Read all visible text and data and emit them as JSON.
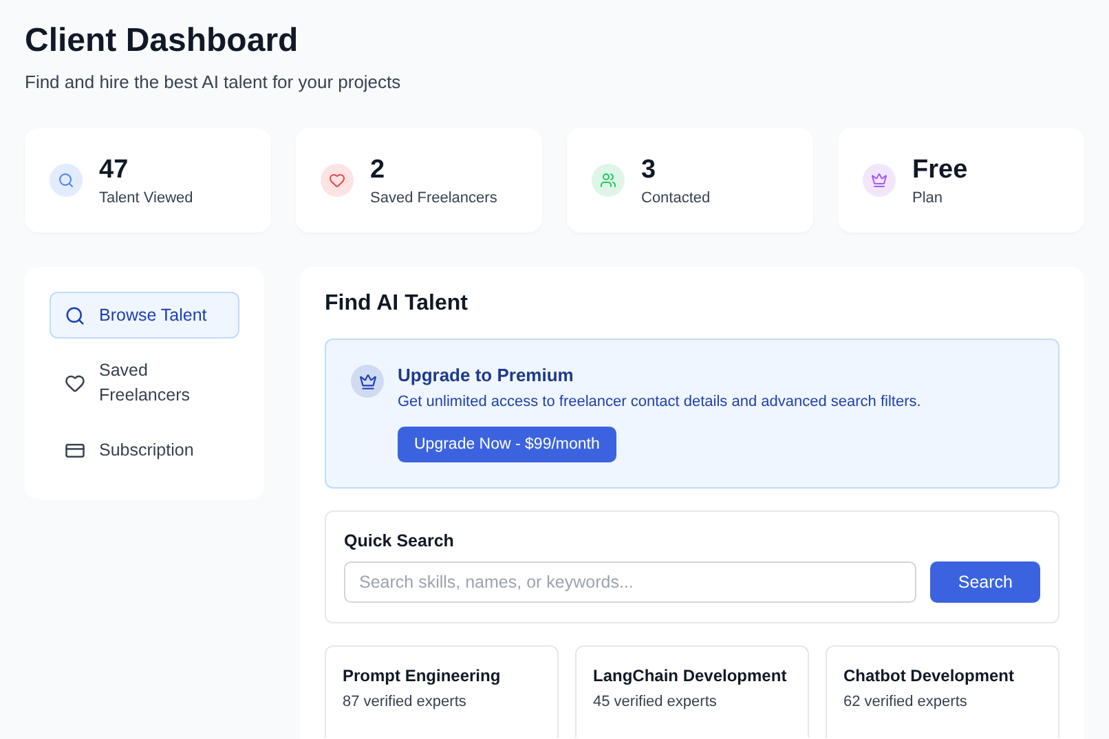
{
  "header": {
    "title": "Client Dashboard",
    "subtitle": "Find and hire the best AI talent for your projects"
  },
  "stats": [
    {
      "value": "47",
      "label": "Talent Viewed",
      "color": "#3b82f6"
    },
    {
      "value": "2",
      "label": "Saved Freelancers",
      "color": "#ef4444"
    },
    {
      "value": "3",
      "label": "Contacted",
      "color": "#22c55e"
    },
    {
      "value": "Free",
      "label": "Plan",
      "color": "#a855f7"
    }
  ],
  "sidebar": {
    "items": [
      {
        "label": "Browse Talent",
        "selected": true
      },
      {
        "label": "Saved Freelancers",
        "selected": false
      },
      {
        "label": "Subscription",
        "selected": false
      }
    ]
  },
  "main": {
    "title": "Find AI Talent",
    "upgrade": {
      "title": "Upgrade to Premium",
      "text": "Get unlimited access to freelancer contact details and advanced search filters.",
      "button": "Upgrade Now - $99/month"
    },
    "search": {
      "title": "Quick Search",
      "placeholder": "Search skills, names, or keywords...",
      "button": "Search"
    },
    "categories": [
      {
        "name": "Prompt Engineering",
        "count": "87 verified experts"
      },
      {
        "name": "LangChain Development",
        "count": "45 verified experts"
      },
      {
        "name": "Chatbot Development",
        "count": "62 verified experts"
      }
    ]
  }
}
